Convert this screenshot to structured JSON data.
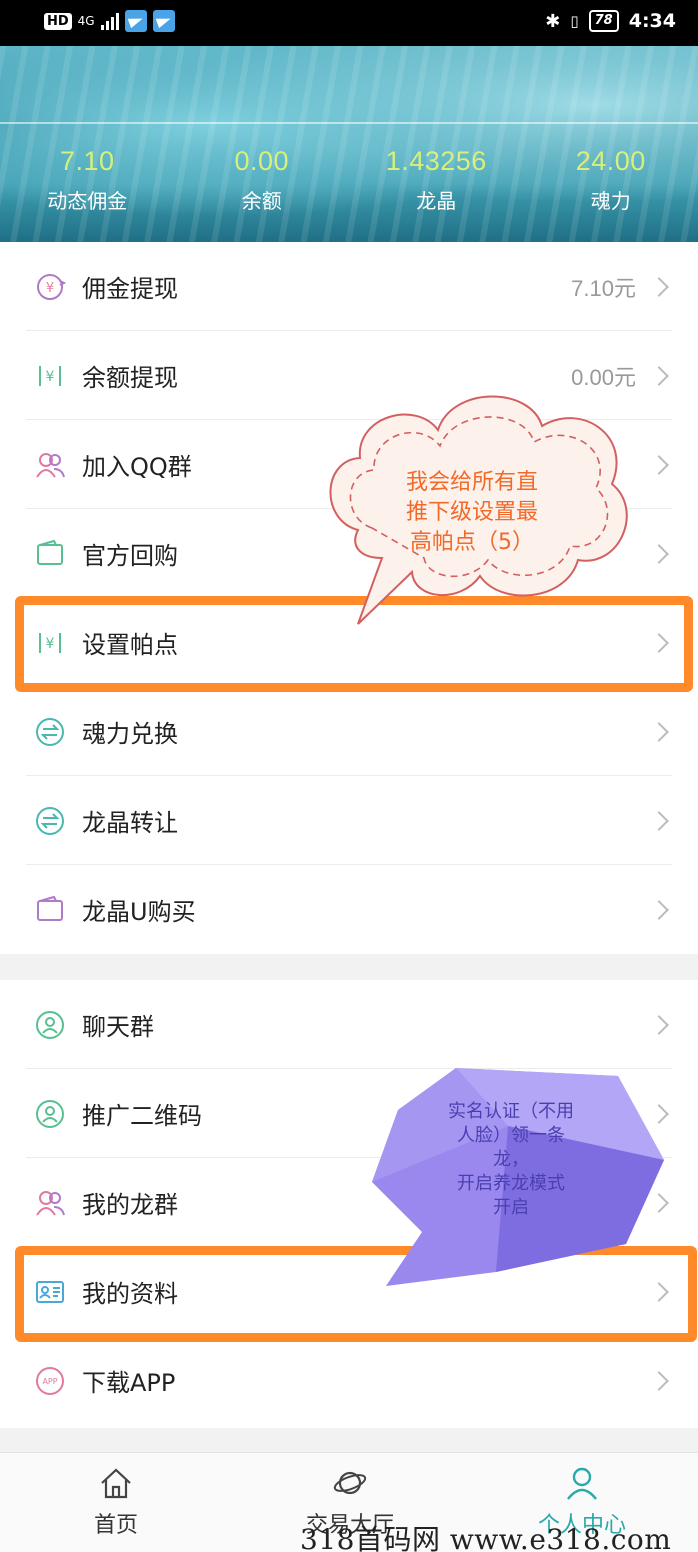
{
  "status_bar": {
    "hd": "HD",
    "network": "4G",
    "battery": "78",
    "time": "4:34"
  },
  "stats": [
    {
      "value": "7.10",
      "label": "动态佣金"
    },
    {
      "value": "0.00",
      "label": "余额"
    },
    {
      "value": "1.43256",
      "label": "龙晶"
    },
    {
      "value": "24.00",
      "label": "魂力"
    }
  ],
  "menu1": [
    {
      "label": "佣金提现",
      "value": "7.10元",
      "icon": "yuan-circle-icon"
    },
    {
      "label": "余额提现",
      "value": "0.00元",
      "icon": "yuan-exchange-icon"
    },
    {
      "label": "加入QQ群",
      "value": "",
      "icon": "users-icon"
    },
    {
      "label": "官方回购",
      "value": "",
      "icon": "wallet-icon"
    },
    {
      "label": "设置帕点",
      "value": "",
      "icon": "yuan-exchange-icon"
    },
    {
      "label": "魂力兑换",
      "value": "",
      "icon": "swap-icon"
    },
    {
      "label": "龙晶转让",
      "value": "",
      "icon": "swap-icon"
    },
    {
      "label": "龙晶U购买",
      "value": "",
      "icon": "wallet-icon"
    }
  ],
  "menu2": [
    {
      "label": "聊天群",
      "icon": "user-circle-icon"
    },
    {
      "label": "推广二维码",
      "icon": "user-circle-icon"
    },
    {
      "label": "我的龙群",
      "icon": "users-icon"
    },
    {
      "label": "我的资料",
      "icon": "profile-card-icon"
    },
    {
      "label": "下载APP",
      "icon": "app-icon"
    }
  ],
  "callout_cloud": {
    "line1": "我会给所有直",
    "line2": "推下级设置最",
    "line3": "高帕点（5）"
  },
  "callout_poly": {
    "line1": "实名认证（不用",
    "line2": "人脸）领一条",
    "line3": "龙，",
    "line4": "开启养龙模式",
    "line5": "开启"
  },
  "tabs": [
    {
      "label": "首页",
      "icon": "home-icon"
    },
    {
      "label": "交易大厅",
      "icon": "planet-icon"
    },
    {
      "label": "个人中心",
      "icon": "person-icon"
    }
  ],
  "watermark": "318首码网 www.e318.com",
  "colors": {
    "accent": "#29a9a9",
    "highlight": "#ff8a2a",
    "stat_value": "#d8f07a"
  }
}
